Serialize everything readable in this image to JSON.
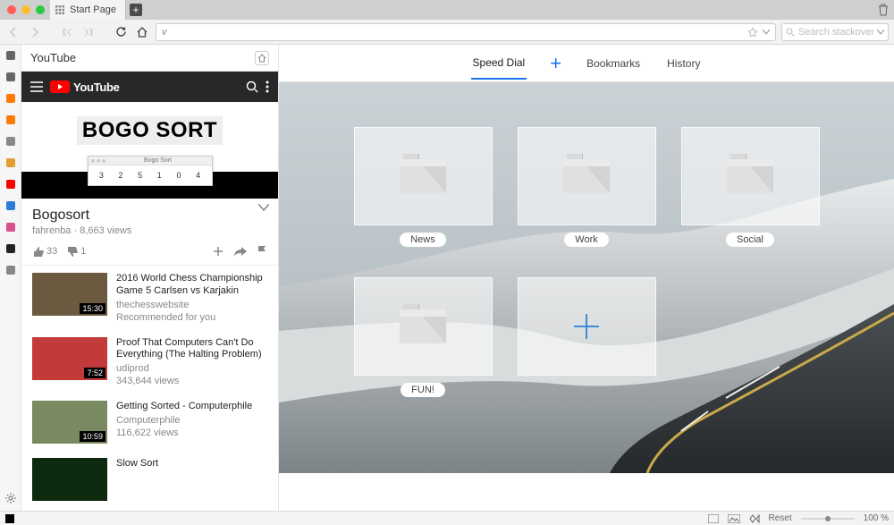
{
  "window": {
    "tab_title": "Start Page",
    "trash_icon": "trash"
  },
  "toolbar": {
    "address_value": "v",
    "search_placeholder": "Search stackoverflow"
  },
  "panel": {
    "title": "YouTube",
    "yt_brand": "YouTube",
    "video": {
      "hero_title": "BOGO SORT",
      "subwin_caption": "Bogo Sort",
      "subwin_values": [
        "3",
        "2",
        "5",
        "1",
        "0",
        "4"
      ],
      "title": "Bogosort",
      "channel": "fahrenba",
      "views": "8,663 views",
      "likes": "33",
      "dislikes": "1"
    },
    "suggestions": [
      {
        "title": "2016 World Chess Championship Game 5 Carlsen vs Karjakin",
        "channel": "thechesswebsite",
        "meta": "Recommended for you",
        "duration": "15:30",
        "thumb": "#6b5a3f"
      },
      {
        "title": "Proof That Computers Can't Do Everything (The Halting Problem)",
        "channel": "udiprod",
        "meta": "343,644 views",
        "duration": "7:52",
        "thumb": "#c33a3a"
      },
      {
        "title": "Getting Sorted - Computerphile",
        "channel": "Computerphile",
        "meta": "116,622 views",
        "duration": "10:59",
        "thumb": "#7a8a60"
      },
      {
        "title": "Slow Sort",
        "channel": "",
        "meta": "",
        "duration": "",
        "thumb": "#0e2a0e"
      }
    ]
  },
  "speeddial": {
    "tabs": {
      "speed_dial": "Speed Dial",
      "bookmarks": "Bookmarks",
      "history": "History"
    },
    "tiles": [
      {
        "label": "News"
      },
      {
        "label": "Work"
      },
      {
        "label": "Social"
      },
      {
        "label": "FUN!"
      }
    ]
  },
  "status": {
    "reset": "Reset",
    "zoom": "100 %"
  },
  "rail": {
    "items": [
      {
        "name": "bookmarks-icon",
        "color": "#666"
      },
      {
        "name": "downloads-icon",
        "color": "#666"
      },
      {
        "name": "hn-icon",
        "color": "#ff7a00"
      },
      {
        "name": "gear-orange-icon",
        "color": "#ff7a00"
      },
      {
        "name": "search-panel-icon",
        "color": "#888"
      },
      {
        "name": "brush-icon",
        "color": "#e0a030"
      },
      {
        "name": "youtube-icon",
        "color": "#ff0000"
      },
      {
        "name": "trello-icon",
        "color": "#2e7bd6"
      },
      {
        "name": "slack-icon",
        "color": "#d94f8c"
      },
      {
        "name": "github-icon",
        "color": "#222"
      },
      {
        "name": "add-panel-icon",
        "color": "#888"
      }
    ]
  }
}
